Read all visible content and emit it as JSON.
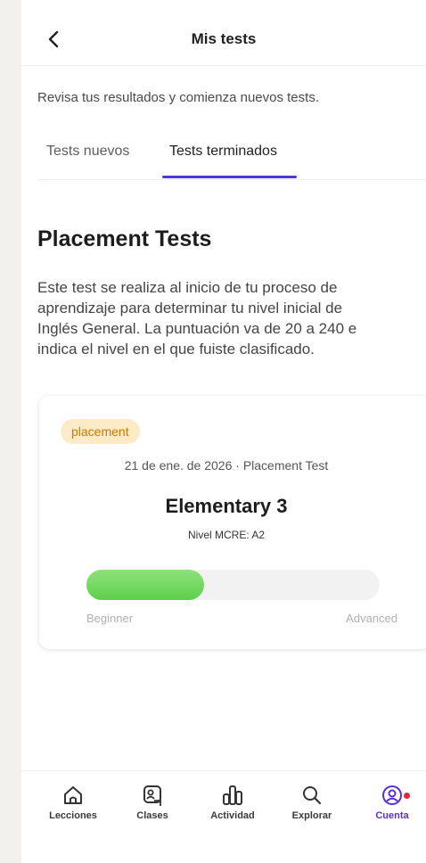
{
  "header": {
    "title": "Mis tests",
    "back_icon": "chevron-left-icon"
  },
  "subtitle": "Revisa tus resultados y comienza nuevos tests.",
  "tabs": [
    {
      "label": "Tests nuevos",
      "active": false
    },
    {
      "label": "Tests terminados",
      "active": true
    }
  ],
  "section": {
    "title": "Placement Tests",
    "description": "Este test se realiza al inicio de tu proceso de aprendizaje para determinar tu nivel inicial de Inglés General. La puntuación va de 20 a 240 e indica el nivel en el que fuiste clasificado."
  },
  "card": {
    "badge": "placement",
    "meta": "21 de ene. de 2026 · Placement Test",
    "level": "Elementary 3",
    "cefr": "Nivel MCRE: A2",
    "progress_fraction": 0.4,
    "scale_min": "Beginner",
    "scale_max": "Advanced"
  },
  "bottom_nav": [
    {
      "label": "Lecciones",
      "icon": "home-icon",
      "active": false
    },
    {
      "label": "Clases",
      "icon": "classes-icon",
      "active": false
    },
    {
      "label": "Actividad",
      "icon": "activity-icon",
      "active": false
    },
    {
      "label": "Explorar",
      "icon": "search-icon",
      "active": false
    },
    {
      "label": "Cuenta",
      "icon": "account-icon",
      "active": true,
      "notification": true
    }
  ],
  "colors": {
    "accent": "#4b38d9",
    "active_nav": "#5b2fd0",
    "progress": "#6fd65a",
    "badge_bg": "#fdebc8",
    "badge_text": "#c47a00",
    "notification_dot": "#e8243a"
  }
}
